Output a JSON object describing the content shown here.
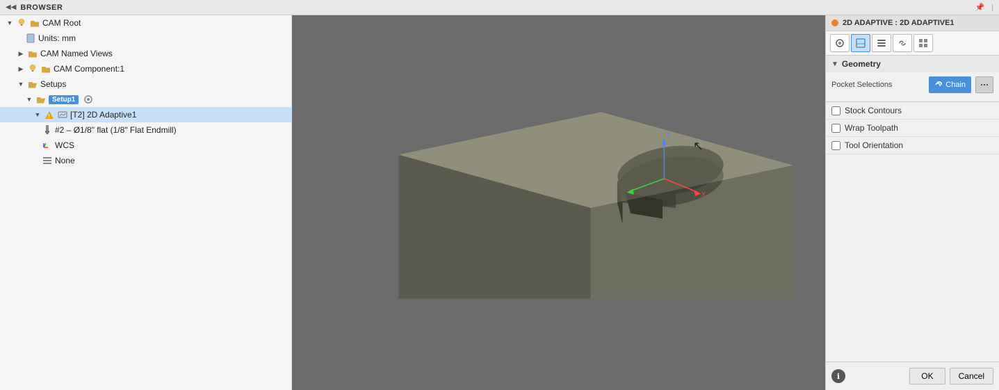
{
  "topbar": {
    "title": "BROWSER",
    "pin_icon": "📌"
  },
  "sidebar": {
    "items": [
      {
        "id": "cam-root",
        "label": "CAM Root",
        "indent": 1,
        "has_arrow": true,
        "arrow_down": true,
        "icon": "root",
        "selected": false
      },
      {
        "id": "units",
        "label": "Units: mm",
        "indent": 2,
        "has_arrow": false,
        "icon": "doc",
        "selected": false
      },
      {
        "id": "named-views",
        "label": "CAM Named Views",
        "indent": 2,
        "has_arrow": true,
        "arrow_down": false,
        "icon": "folder",
        "selected": false
      },
      {
        "id": "cam-component",
        "label": "CAM Component:1",
        "indent": 2,
        "has_arrow": true,
        "arrow_down": false,
        "icon": "folder",
        "selected": false
      },
      {
        "id": "setups",
        "label": "Setups",
        "indent": 2,
        "has_arrow": true,
        "arrow_down": true,
        "icon": "folder-open",
        "selected": false
      },
      {
        "id": "setup1",
        "label": "Setup1",
        "indent": 3,
        "has_arrow": true,
        "arrow_down": true,
        "icon": "gear",
        "selected": false,
        "badge": true
      },
      {
        "id": "t2-adaptive",
        "label": "[T2] 2D Adaptive1",
        "indent": 4,
        "has_arrow": true,
        "arrow_down": true,
        "icon": "warning",
        "selected": true
      },
      {
        "id": "endmill",
        "label": "#2 – Ø1/8\" flat (1/8\" Flat Endmill)",
        "indent": 5,
        "has_arrow": false,
        "icon": "tool",
        "selected": false
      },
      {
        "id": "wcs",
        "label": "WCS",
        "indent": 5,
        "has_arrow": false,
        "icon": "coord",
        "selected": false
      },
      {
        "id": "none",
        "label": "None",
        "indent": 5,
        "has_arrow": false,
        "icon": "bars",
        "selected": false
      }
    ]
  },
  "panel": {
    "header_title": "2D ADAPTIVE : 2D ADAPTIVE1",
    "toolbar_buttons": [
      {
        "id": "tb-tool",
        "icon": "🔧",
        "active": false
      },
      {
        "id": "tb-geom",
        "icon": "⬡",
        "active": true
      },
      {
        "id": "tb-passes",
        "icon": "≡",
        "active": false
      },
      {
        "id": "tb-link",
        "icon": "🔗",
        "active": false
      },
      {
        "id": "tb-extra",
        "icon": "⊞",
        "active": false
      }
    ],
    "geometry_section": {
      "title": "Geometry",
      "pocket_label": "Pocket Selections",
      "chain_label": "Chain",
      "stock_contours_label": "Stock Contours",
      "wrap_toolpath_label": "Wrap Toolpath",
      "tool_orientation_label": "Tool Orientation"
    },
    "footer": {
      "info_label": "ℹ",
      "ok_label": "OK",
      "cancel_label": "Cancel"
    }
  },
  "colors": {
    "accent_blue": "#4a90d9",
    "panel_bg": "#f0f0f0",
    "viewport_bg": "#6b6b6b",
    "model_top": "#7a7a6a",
    "model_front": "#5a5a50",
    "model_right": "#686858"
  }
}
